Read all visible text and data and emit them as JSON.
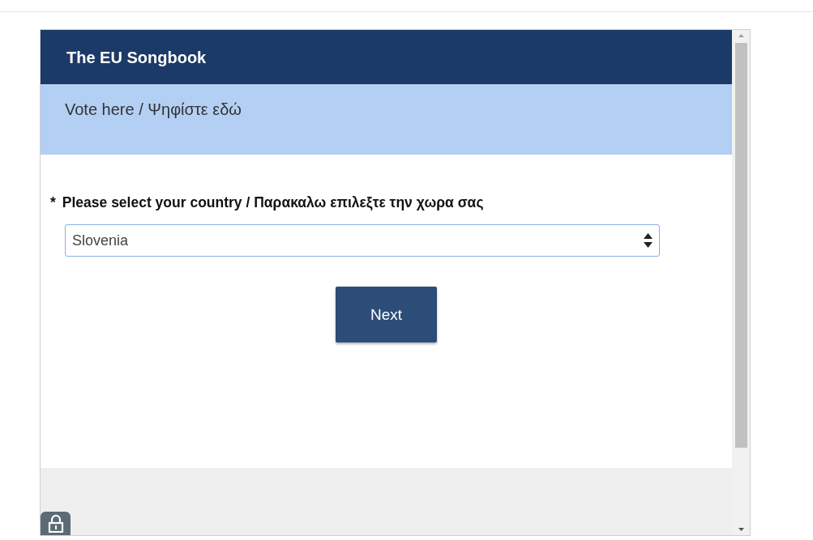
{
  "survey": {
    "title": "The EU Songbook",
    "subtitle": "Vote here / Ψηφίστε εδώ"
  },
  "question": {
    "required_mark": "*",
    "label": "Please select your country / Παρακαλω επιλεξτε την χωρα σας",
    "value": "Slovenia"
  },
  "buttons": [
    {
      "label": "Next"
    }
  ]
}
